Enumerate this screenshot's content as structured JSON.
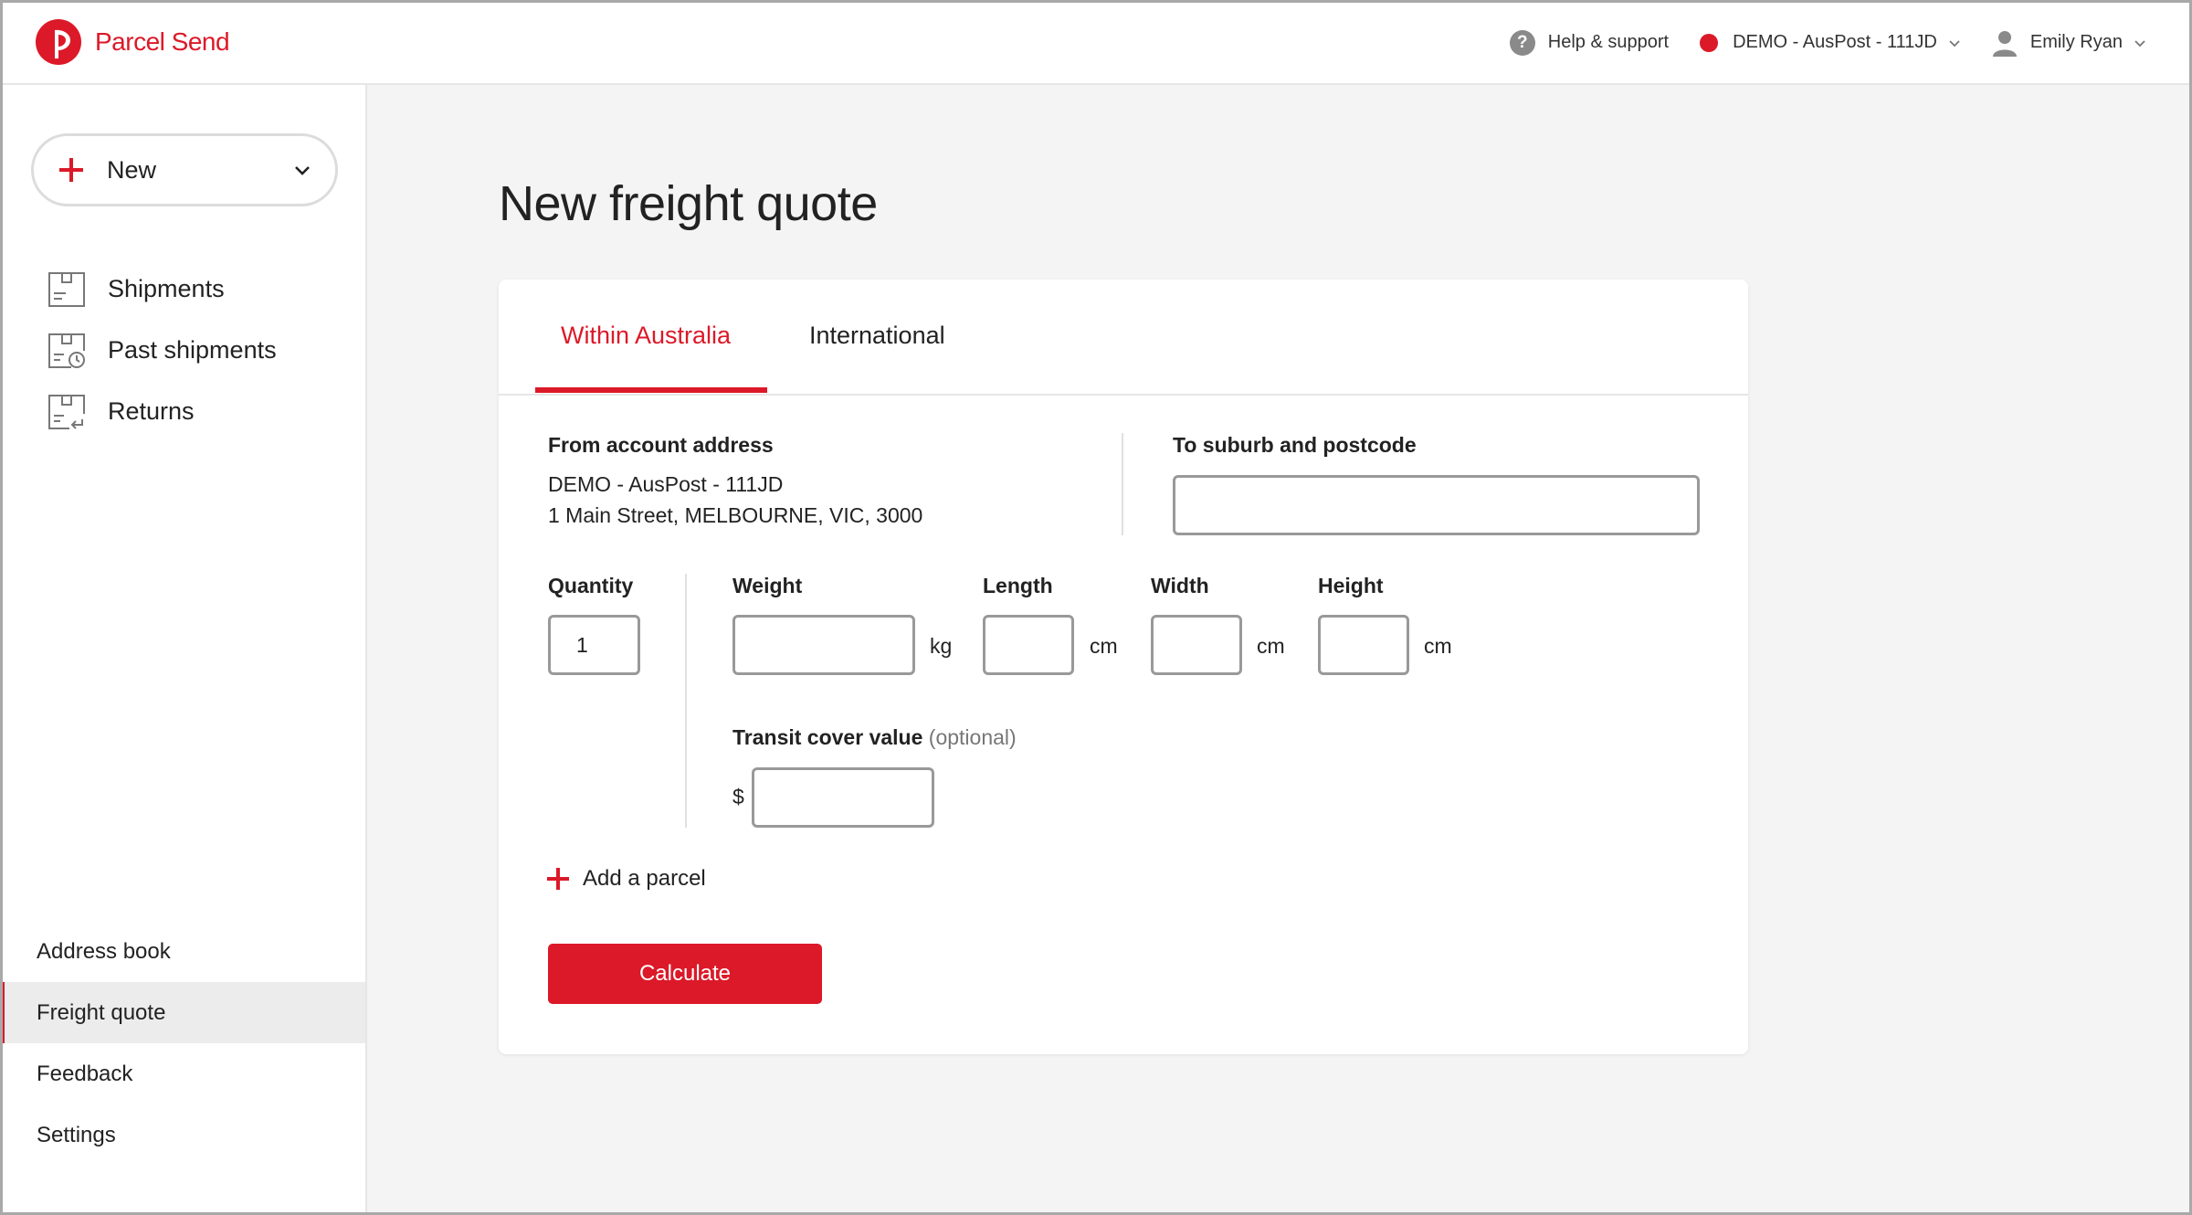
{
  "header": {
    "brand_name": "Parcel Send",
    "help_label": "Help & support",
    "account_label": "DEMO - AusPost - 111JD",
    "user_name": "Emily Ryan",
    "brand_color": "#dc1928"
  },
  "sidebar": {
    "new_button_label": "New",
    "items": [
      {
        "label": "Shipments",
        "icon": "box-icon"
      },
      {
        "label": "Past shipments",
        "icon": "box-clock-icon"
      },
      {
        "label": "Returns",
        "icon": "box-return-icon"
      }
    ],
    "bottom_items": [
      {
        "label": "Address book",
        "active": false
      },
      {
        "label": "Freight quote",
        "active": true
      },
      {
        "label": "Feedback",
        "active": false
      },
      {
        "label": "Settings",
        "active": false
      }
    ]
  },
  "main": {
    "title": "New freight quote",
    "tabs": [
      {
        "label": "Within Australia",
        "active": true
      },
      {
        "label": "International",
        "active": false
      }
    ],
    "from": {
      "label": "From account address",
      "line1": "DEMO - AusPost - 111JD",
      "line2": "1 Main Street, MELBOURNE, VIC, 3000"
    },
    "to": {
      "label": "To suburb and postcode",
      "value": ""
    },
    "quantity": {
      "label": "Quantity",
      "value": "1"
    },
    "weight": {
      "label": "Weight",
      "value": "",
      "unit": "kg"
    },
    "length": {
      "label": "Length",
      "value": "",
      "unit": "cm"
    },
    "width": {
      "label": "Width",
      "value": "",
      "unit": "cm"
    },
    "height": {
      "label": "Height",
      "value": "",
      "unit": "cm"
    },
    "transit": {
      "label": "Transit cover value",
      "optional": "(optional)",
      "currency": "$",
      "value": ""
    },
    "add_parcel_label": "Add a parcel",
    "calculate_label": "Calculate"
  }
}
